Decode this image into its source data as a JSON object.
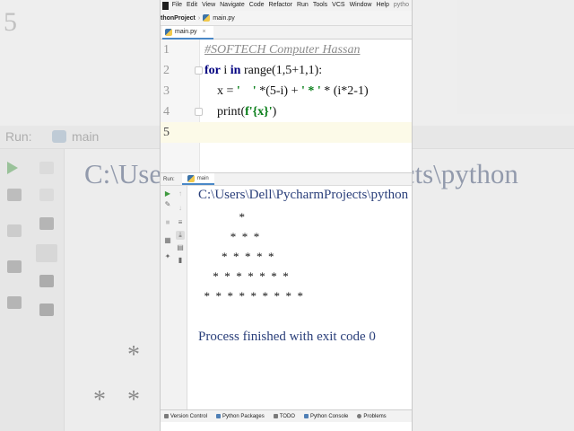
{
  "menu": {
    "items": [
      "File",
      "Edit",
      "View",
      "Navigate",
      "Code",
      "Refactor",
      "Run",
      "Tools",
      "VCS",
      "Window",
      "Help",
      "pytho"
    ]
  },
  "navbar": {
    "project": "thonProject",
    "file": "main.py"
  },
  "editor_tab": {
    "label": "main.py"
  },
  "editor": {
    "line_numbers": [
      "1",
      "2",
      "3",
      "4",
      "5"
    ],
    "comment": "#SOFTECH Computer Hassan",
    "l2": {
      "kw_for": "for",
      "var": " i ",
      "kw_in": "in",
      "rest": " range(1,5+1,1):"
    },
    "l3": {
      "a": "    x = ",
      "s1": "'    '",
      "b": " *(5-i) + ",
      "s2": "' * '",
      "c": " * (i*2-1)"
    },
    "l4": {
      "a": "    print(",
      "s1": "f'{x}'",
      "b": ")"
    }
  },
  "run": {
    "label": "Run:",
    "tab": "main"
  },
  "console": {
    "path": "C:\\Users\\Dell\\PycharmProjects\\python",
    "rows": [
      "              *",
      "           *  *  *",
      "        *  *  *  *  *",
      "     *  *  *  *  *  *  *",
      "  *  *  *  *  *  *  *  *  *"
    ],
    "exit": "Process finished with exit code 0"
  },
  "statusbar": {
    "items": [
      "Version Control",
      "Python Packages",
      "TODO",
      "Python Console",
      "Problems"
    ]
  },
  "background": {
    "line_number": "5",
    "run_label": "Run:",
    "tab": "main",
    "path": "C:\\Users\\Dell\\PycharmProjects\\python",
    "stars": [
      "*",
      "*",
      "*"
    ]
  }
}
